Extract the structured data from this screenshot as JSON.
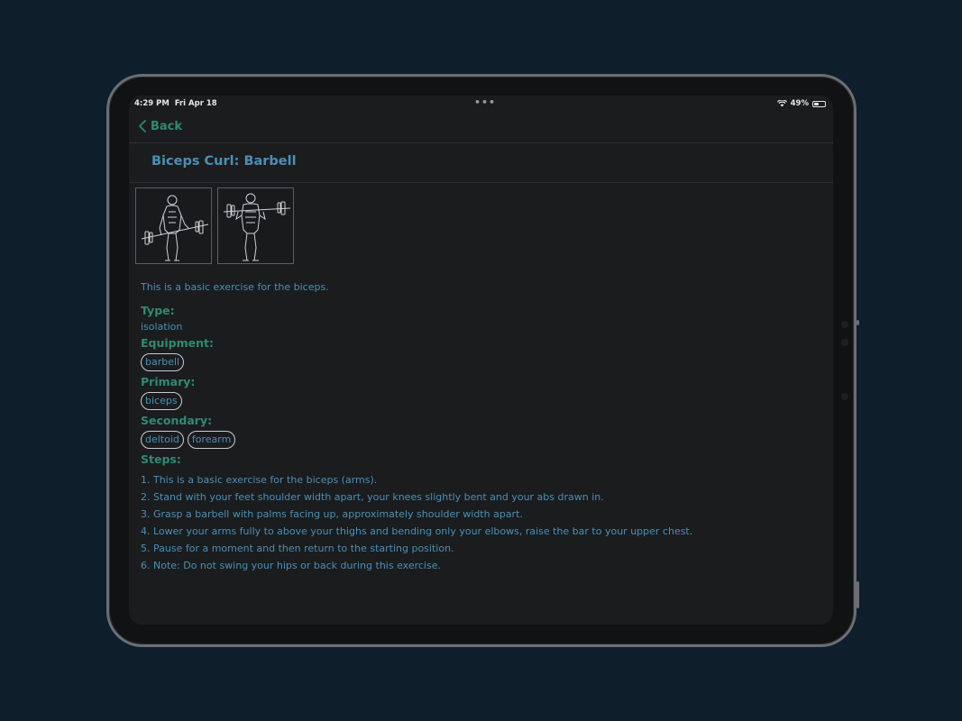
{
  "status_bar": {
    "time": "4:29 PM",
    "date": "Fri Apr 18",
    "dots": "•••",
    "battery_percent": "49%"
  },
  "nav": {
    "back_label": "Back"
  },
  "page": {
    "title": "Biceps Curl: Barbell",
    "description": "This is a basic exercise for the biceps."
  },
  "images": [
    {
      "icon": "barbell-curl-start-illustration"
    },
    {
      "icon": "barbell-curl-end-illustration"
    }
  ],
  "details": {
    "type_label": "Type:",
    "type_value": "isolation",
    "equipment_label": "Equipment:",
    "equipment": [
      "barbell"
    ],
    "primary_label": "Primary:",
    "primary": [
      "biceps"
    ],
    "secondary_label": "Secondary:",
    "secondary": [
      "deltoid",
      "forearm"
    ],
    "steps_label": "Steps:",
    "steps": [
      "1. This is a basic exercise for the biceps (arms).",
      "2. Stand with your feet shoulder width apart, your knees slightly bent and your abs drawn in.",
      "3. Grasp a barbell with palms facing up, approximately shoulder width apart.",
      "4. Lower your arms fully to above your thighs and bending only your elbows, raise the bar to your upper chest.",
      "5. Pause for a moment and then return to the starting position.",
      "6. Note: Do not swing your hips or back during this exercise."
    ]
  },
  "colors": {
    "accent_green": "#2f8a72",
    "accent_blue": "#4a8fb5",
    "screen_bg": "#1b1c1e",
    "backdrop": "#0e1e2b"
  }
}
